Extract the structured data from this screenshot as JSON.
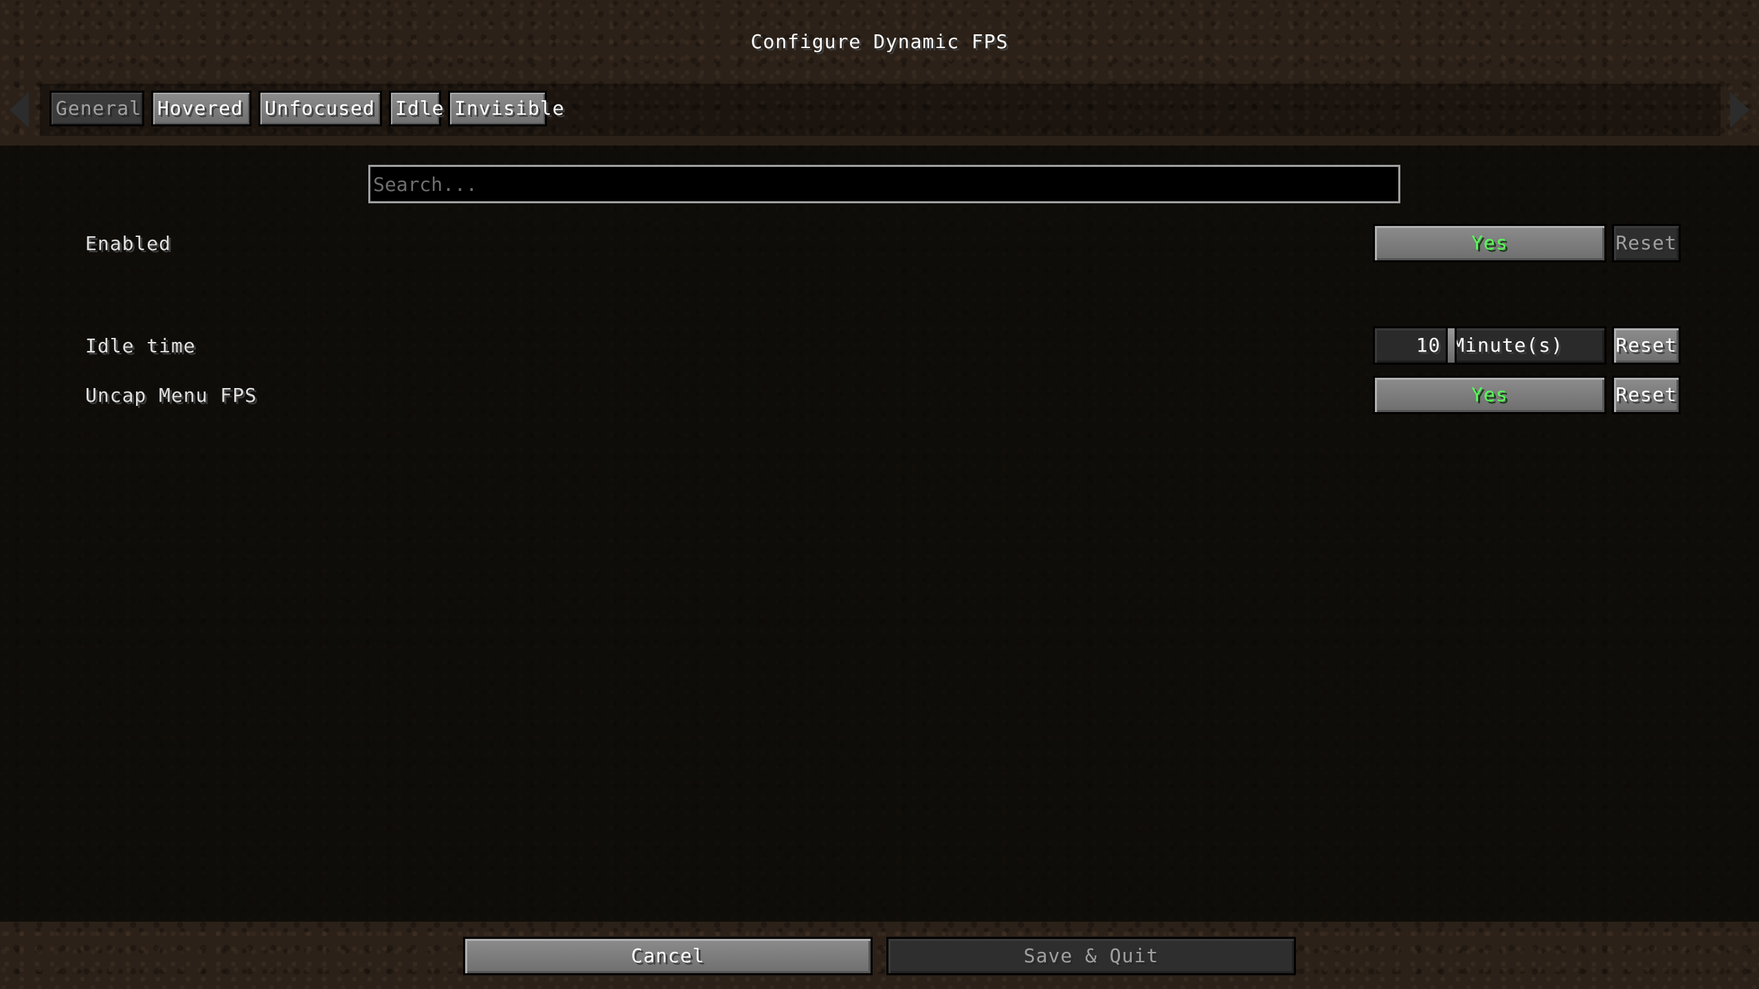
{
  "screen": {
    "title": "Configure Dynamic FPS"
  },
  "tabs": [
    {
      "label": "General",
      "active": true
    },
    {
      "label": "Hovered",
      "active": false
    },
    {
      "label": "Unfocused",
      "active": false
    },
    {
      "label": "Idle",
      "active": false
    },
    {
      "label": "Invisible",
      "active": false
    }
  ],
  "search": {
    "placeholder": "Search...",
    "value": ""
  },
  "options": {
    "enabled": {
      "label": "Enabled",
      "value": "Yes",
      "reset_label": "Reset",
      "reset_enabled": false
    },
    "idle_time": {
      "label": "Idle time",
      "value_number": 10,
      "value_text": "10 Minute(s)",
      "reset_label": "Reset",
      "reset_enabled": true
    },
    "uncap_menu_fps": {
      "label": "Uncap Menu FPS",
      "value": "Yes",
      "reset_label": "Reset",
      "reset_enabled": true
    }
  },
  "footer": {
    "cancel_label": "Cancel",
    "save_label": "Save & Quit",
    "save_enabled": false
  },
  "icons": {
    "left_arrow": "arrow-left-icon",
    "right_arrow": "arrow-right-icon"
  },
  "colors": {
    "value_yes": "#55ff55",
    "text": "#ffffff",
    "disabled_text": "#a0a0a0"
  }
}
